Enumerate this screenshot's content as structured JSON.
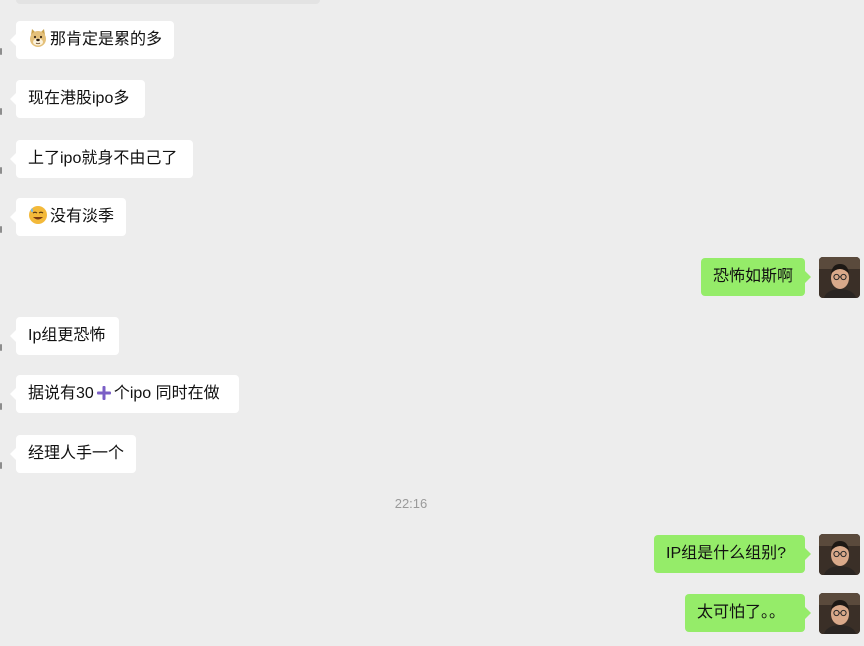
{
  "chat": {
    "messages": [
      {
        "id": "m1",
        "side": "left",
        "icon": "doge-emoji-icon",
        "text": "那肯定是累的多"
      },
      {
        "id": "m2",
        "side": "left",
        "text": "现在港股ipo多"
      },
      {
        "id": "m3",
        "side": "left",
        "text": "上了ipo就身不由己了"
      },
      {
        "id": "m4",
        "side": "left",
        "icon": "sweat-smile-emoji-icon",
        "text": "没有淡季"
      },
      {
        "id": "m5",
        "side": "right",
        "text": "恐怖如斯啊"
      },
      {
        "id": "m6",
        "side": "left",
        "text": "Ip组更恐怖"
      },
      {
        "id": "m7",
        "side": "left",
        "text_before": "据说有30",
        "icon": "plus-icon",
        "text_after": "个ipo 同时在做"
      },
      {
        "id": "m8",
        "side": "left",
        "text": "经理人手一个"
      },
      {
        "id": "m9",
        "side": "right",
        "text": "IP组是什么组别?"
      },
      {
        "id": "m10",
        "side": "right",
        "text": "太可怕了。。"
      }
    ],
    "timestamp": "22:16"
  },
  "colors": {
    "background": "#ededed",
    "incoming_bubble": "#ffffff",
    "outgoing_bubble": "#95ec69",
    "plus_icon": "#7a5ec6",
    "timestamp_text": "#9a9a9a"
  }
}
